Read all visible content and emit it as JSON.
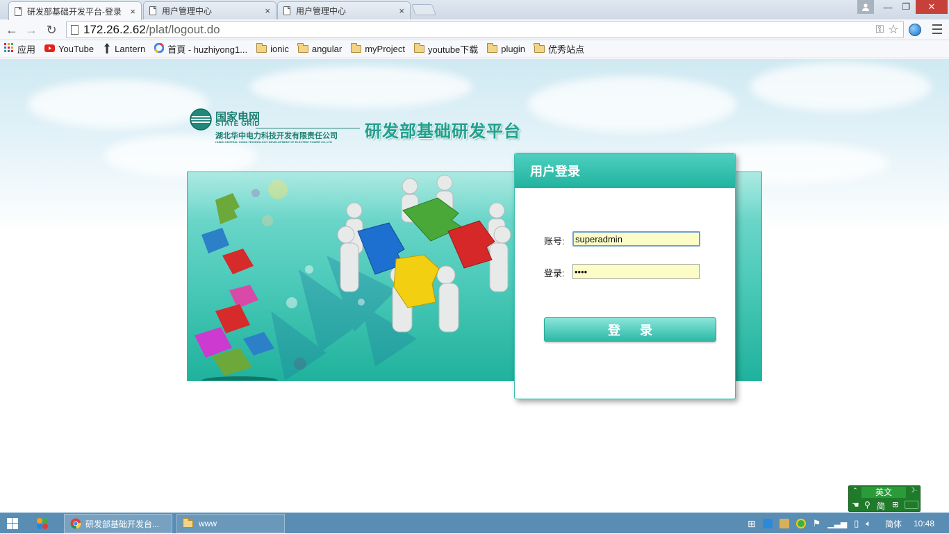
{
  "browser": {
    "tabs": [
      {
        "title": "研发部基础开发平台-登录",
        "active": true
      },
      {
        "title": "用户管理中心",
        "active": false
      },
      {
        "title": "用户管理中心",
        "active": false
      }
    ],
    "tab_close": "×",
    "window_controls": {
      "minimize": "—",
      "maximize": "❐",
      "close": "✕"
    },
    "nav": {
      "back": "←",
      "forward": "→",
      "reload": "↻"
    },
    "address": {
      "host": "172.26.2.62",
      "path": "/plat/logout.do"
    },
    "bookmarks": [
      {
        "label": "应用",
        "icon": "apps-grid-icon"
      },
      {
        "label": "YouTube",
        "icon": "youtube-icon"
      },
      {
        "label": "Lantern",
        "icon": "lantern-icon"
      },
      {
        "label": "首頁 - huzhiyong1...",
        "icon": "google-icon"
      },
      {
        "label": "ionic",
        "icon": "folder-icon"
      },
      {
        "label": "angular",
        "icon": "folder-icon"
      },
      {
        "label": "myProject",
        "icon": "folder-icon"
      },
      {
        "label": "youtube下载",
        "icon": "folder-icon"
      },
      {
        "label": "plugin",
        "icon": "folder-icon"
      },
      {
        "label": "优秀站点",
        "icon": "folder-icon"
      }
    ]
  },
  "page": {
    "logo": {
      "cn_name": "国家电网",
      "en_name": "STATE GRID",
      "company": "湖北华中电力科技开发有限责任公司",
      "company_en": "HUBEI CENTRAL CHINA TECHNOLOGY DEVELOPMENT OF ELECTRIC POWER CO.,LTD"
    },
    "platform_title": "研发部基础研发平台",
    "login": {
      "header": "用户登录",
      "username_label": "账号:",
      "username_value": "superadmin",
      "password_label": "登录:",
      "password_value": "••••",
      "submit_label": "登录"
    }
  },
  "ime": {
    "mode": "英文",
    "simplified": "简"
  },
  "taskbar": {
    "tasks": [
      {
        "label": "研发部基础开发台...",
        "icon": "chrome-icon"
      },
      {
        "label": "www",
        "icon": "folder-icon"
      }
    ],
    "lang": "简体",
    "clock": "10:48"
  },
  "colors": {
    "accent": "#20b39f",
    "input_bg": "#fbfcc8",
    "title_teal": "#21a08e"
  }
}
